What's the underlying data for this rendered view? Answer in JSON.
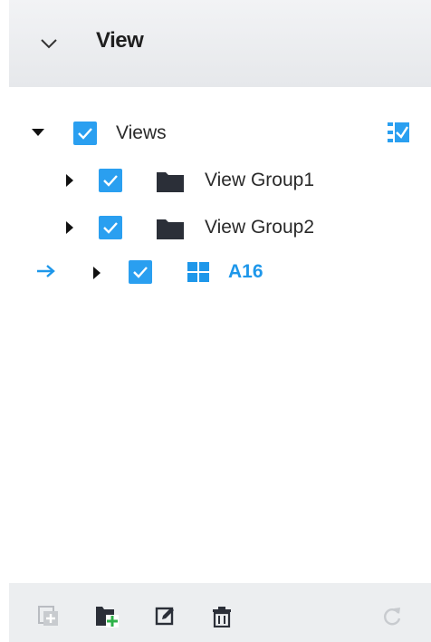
{
  "header": {
    "title": "View",
    "icon": "chevron-down-icon"
  },
  "tree": {
    "root": {
      "label": "Views",
      "checked": true
    },
    "groups": [
      {
        "label": "View Group1",
        "checked": true,
        "icon": "folder-icon"
      },
      {
        "label": "View Group2",
        "checked": true,
        "icon": "folder-icon"
      }
    ],
    "view": {
      "label": "A16",
      "checked": true,
      "icon": "grid-view-icon",
      "selected": true
    }
  },
  "toolbar": {
    "buttons": [
      "add-view-icon",
      "add-group-icon",
      "edit-icon",
      "delete-icon",
      "refresh-icon"
    ]
  },
  "colors": {
    "accent": "#1e97ea",
    "checkbox": "#2a9ff0",
    "folder": "#2b2f38"
  }
}
